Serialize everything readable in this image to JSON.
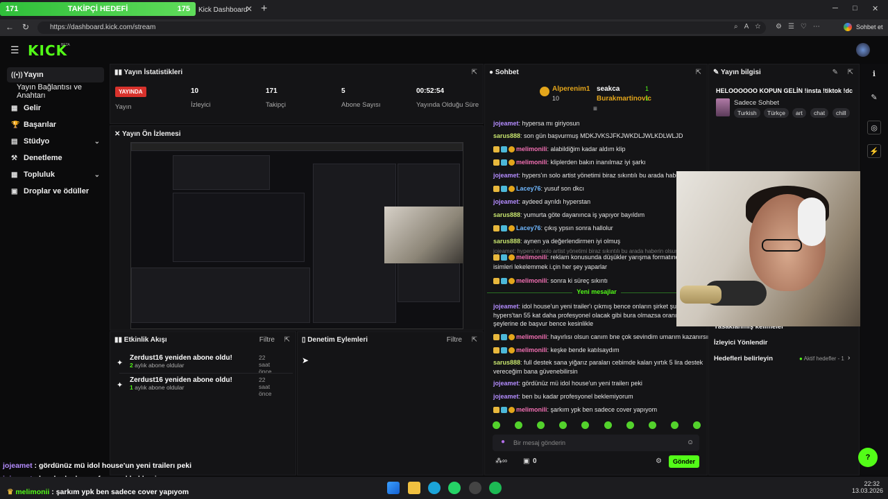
{
  "goal_bar": {
    "left": "171",
    "label": "TAKİPÇİ HEDEFİ",
    "right": "175",
    "progress": 0.977
  },
  "browser": {
    "tab_title": "Kick Dashboard",
    "url": "https://dashboard.kick.com/stream",
    "profile_label": "Sohbet et"
  },
  "brand": {
    "logo": "KICK",
    "beta": "BETA",
    "accent": "#53fc18"
  },
  "sidebar": {
    "items": [
      {
        "label": "Yayın",
        "icon": "radio-icon"
      },
      {
        "label": "Yayın Bağlantısı ve Anahtarı"
      },
      {
        "label": "Gelir",
        "icon": "money-icon"
      },
      {
        "label": "Başarılar",
        "icon": "trophy-icon"
      },
      {
        "label": "Stüdyo",
        "icon": "studio-icon"
      },
      {
        "label": "Denetleme",
        "icon": "gavel-icon"
      },
      {
        "label": "Topluluk",
        "icon": "community-icon"
      },
      {
        "label": "Droplar ve ödüller",
        "icon": "gift-icon"
      }
    ]
  },
  "stats": {
    "title": "Yayın İstatistikleri",
    "live_badge": "YAYINDA",
    "live_label": "Yayın",
    "viewers": "10",
    "viewers_label": "İzleyici",
    "followers": "171",
    "followers_label": "Takipçi",
    "subs": "5",
    "subs_label": "Abone Sayısı",
    "uptime": "00:52:54",
    "uptime_label": "Yayında Olduğu Süre"
  },
  "preview": {
    "title": "Yayın Ön İzlemesi"
  },
  "activity": {
    "title": "Etkinlik Akışı",
    "filter": "Filtre",
    "items": [
      {
        "title": "Zerdust16 yeniden abone oldu!",
        "months": "2",
        "sub": "aylık abone oldular",
        "time": "22 saat önce"
      },
      {
        "title": "Zerdust16 yeniden abone oldu!",
        "months": "1",
        "sub": "aylık abone oldular",
        "time": "22 saat önce"
      }
    ]
  },
  "moderation": {
    "title": "Denetim Eylemleri",
    "filter": "Filtre"
  },
  "chat": {
    "title": "Sohbet",
    "top_gifters": [
      {
        "name": "Alperenim1",
        "count": "10"
      },
      {
        "name": "seakca",
        "count": "1"
      },
      {
        "name": "Burakmartinovic",
        "count": "1"
      }
    ],
    "messages": [
      {
        "user": "jojeamet",
        "color": "#b48cff",
        "text": ": hypersa mı giriyosun",
        "badges": false
      },
      {
        "user": "sarus888",
        "color": "#c6e36d",
        "text": ": son gün başvurmuş MDKJVKSJFKJWKDLJWLKDLWLJD",
        "badges": false
      },
      {
        "user": "melimonili",
        "color": "#f06fb1",
        "text": ": alabildiğim kadar aldım klip",
        "badges": true
      },
      {
        "user": "melimonili",
        "color": "#f06fb1",
        "text": ": kliplerden bakın inanılmaz iyi şarkı",
        "badges": true
      },
      {
        "user": "jojeamet",
        "color": "#b48cff",
        "text": ": hypers'ın solo artist yönetimi biraz sıkıntılı bu arada haberin ol",
        "badges": false
      },
      {
        "user": "Lacey76",
        "color": "#6fb8ff",
        "text": ": yusuf son dkcı",
        "badges": true
      },
      {
        "user": "jojeamet",
        "color": "#b48cff",
        "text": ": aydeed ayrıldı hyperstan",
        "badges": false
      },
      {
        "user": "sarus888",
        "color": "#c6e36d",
        "text": ": yumurta göte dayanınca iş yapıyor bayıldım",
        "badges": false
      },
      {
        "user": "Lacey76",
        "color": "#6fb8ff",
        "text": ": çıkış ypsın sonra hallolur",
        "badges": true
      },
      {
        "user": "sarus888",
        "color": "#c6e36d",
        "text": ": aynen ya değerlendirmen iyi olmuş",
        "badges": false
      },
      {
        "user": "melimonili",
        "color": "#f06fb1",
        "text": ": reklam konusunda düşükler yarışma formatında iy",
        "badges": true
      },
      {
        "user": "",
        "color": "#e6e6e6",
        "text": "isimleri lekelemmek i.çin her şey yaparlar",
        "badges": false
      },
      {
        "user": "melimonili",
        "color": "#f06fb1",
        "text": ": sonra ki süreç sıkıntı",
        "badges": true
      },
      {
        "user": "jojeamet",
        "color": "#b48cff",
        "text": ": idol house'un yeni trailer'ı çıkmış bence onların şirket şu sırala",
        "badges": false
      },
      {
        "user": "",
        "color": "#e6e6e6",
        "text": "hypers'tan 55 kat daha profesyonel olacak gibi bura olmazsa oranın bir",
        "badges": false
      },
      {
        "user": "",
        "color": "#e6e6e6",
        "text": "şeylerine de başvur bence kesinlikle",
        "badges": false
      },
      {
        "user": "melimonili",
        "color": "#f06fb1",
        "text": ": hayırlısı olsun canım bne çok sevindim umarım kazanırsın",
        "badges": true
      },
      {
        "user": "melimonili",
        "color": "#f06fb1",
        "text": ": keşke bende katılsaydım",
        "badges": true
      },
      {
        "user": "sarus888",
        "color": "#c6e36d",
        "text": ": full destek sana yiğarız paraları cebimde kalan yırtık 5 lira destek",
        "badges": false
      },
      {
        "user": "",
        "color": "#e6e6e6",
        "text": "vereceğim bana güvenebilirsin",
        "badges": false
      },
      {
        "user": "jojeamet",
        "color": "#b48cff",
        "text": ": gördünüz mü idol house'un yeni trailerı peki",
        "badges": false
      },
      {
        "user": "jojeamet",
        "color": "#b48cff",
        "text": ": ben bu kadar profesyonel beklemiyorum",
        "badges": false
      },
      {
        "user": "melimonili",
        "color": "#f06fb1",
        "text": ": şarkım ypk ben sadece cover yapıyom",
        "badges": true
      }
    ],
    "reply_preview": "jojeamet: hypers'ın solo artist yönetimi biraz sıkıntılı bu arada haberin olsun",
    "new_messages": "Yeni mesajlar",
    "input_placeholder": "Bir mesaj gönderin",
    "send": "Gönder",
    "count": "0"
  },
  "info": {
    "title": "Yayın bilgisi",
    "stream_title": "HELOOOOOO KOPUN GELİN !insta !tiktok !dc",
    "category": "Sadece Sohbet",
    "tags": [
      "Turkish",
      "Türkçe",
      "art",
      "chat",
      "chill"
    ],
    "row1": "Yasaklanmış kelimeler",
    "row2": "İzleyici Yönlendir",
    "row3": "Hedefleri belirleyin",
    "row3_badge": "Aktif hedefler - 1"
  },
  "overlay_chat": [
    {
      "user": "jojeamet",
      "color": "#b48cff",
      "text": " : gördünüz mü idol house'un yeni trailerı peki"
    },
    {
      "user": "jojeamet",
      "color": "#b48cff",
      "text": " : ben bu kadar profesyonel beklemiyorum"
    },
    {
      "user": "melimonii",
      "color": "#53fc18",
      "text": " : şarkım ypk ben sadece cover yapıyom"
    }
  ],
  "clock": {
    "time": "22:32",
    "date": "13.03.2026"
  }
}
